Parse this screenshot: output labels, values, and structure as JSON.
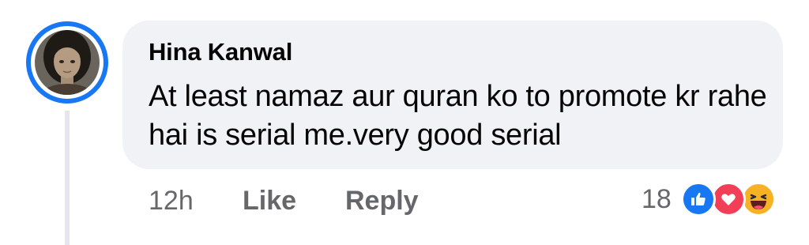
{
  "comment": {
    "author": "Hina Kanwal",
    "text": "At least namaz aur quran ko to promote kr rahe hai is serial me.very good serial",
    "timestamp": "12h",
    "like_label": "Like",
    "reply_label": "Reply",
    "reaction_count": "18",
    "reactions": [
      "like-icon",
      "love-icon",
      "haha-icon"
    ]
  },
  "colors": {
    "accent": "#1877f2",
    "bubble": "#f0f2f5",
    "meta_text": "#65676b",
    "love": "#f33e58",
    "haha": "#f7b125"
  }
}
